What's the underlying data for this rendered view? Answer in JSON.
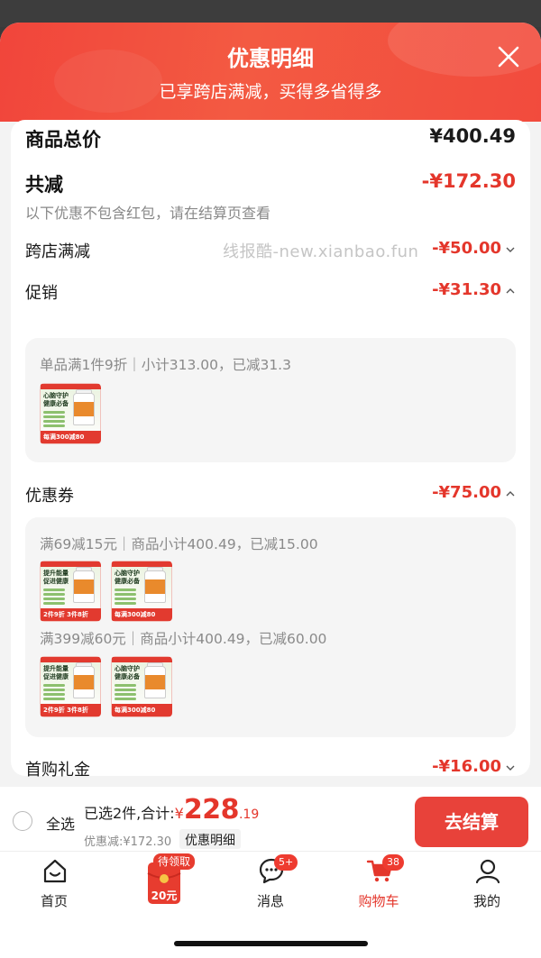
{
  "sheet": {
    "title": "优惠明细",
    "subtitle": "已享跨店满减，买得多省得多"
  },
  "summary": {
    "total_label": "商品总价",
    "total_value": "¥400.49",
    "reduce_label": "共减",
    "reduce_value": "-¥172.30",
    "note": "以下优惠不包含红包，请在结算页查看"
  },
  "watermark": "线报酷-new.xianbao.fun",
  "discounts": {
    "cross_store": {
      "label": "跨店满减",
      "value": "-¥50.00",
      "expanded": false
    },
    "promotion": {
      "label": "促销",
      "value": "-¥31.30",
      "expanded": true,
      "rule": "单品满1件9折｜小计313.00，已减31.3",
      "products": [
        {
          "tagline": "心脑守护 健康必备",
          "promo": "每满300减80"
        }
      ]
    },
    "coupon": {
      "label": "优惠券",
      "value": "-¥75.00",
      "expanded": true,
      "rules": [
        {
          "text": "满69减15元｜商品小计400.49，已减15.00",
          "products": [
            {
              "tagline": "提升能量 促进健康",
              "promo": "2件9折 3件8折"
            },
            {
              "tagline": "心脑守护 健康必备",
              "promo": "每满300减80"
            }
          ]
        },
        {
          "text": "满399减60元｜商品小计400.49，已减60.00",
          "products": [
            {
              "tagline": "提升能量 促进健康",
              "promo": "2件9折 3件8折"
            },
            {
              "tagline": "心脑守护 健康必备",
              "promo": "每满300减80"
            }
          ]
        }
      ]
    },
    "first_gift": {
      "label": "首购礼金",
      "value": "-¥16.00",
      "expanded": false
    }
  },
  "checkout": {
    "select_all": "全选",
    "selected_text": "已选2件,合计:",
    "currency": "¥",
    "total_int": "228",
    "total_dec": ".19",
    "discount_text": "优惠减:¥172.30",
    "detail_label": "优惠明细",
    "button": "去结算"
  },
  "tabs": [
    {
      "label": "首页",
      "icon": "home-icon"
    },
    {
      "label": "",
      "icon": "red-packet-icon",
      "badge": "待领取",
      "amount": "20元"
    },
    {
      "label": "消息",
      "icon": "message-icon",
      "badge": "5+"
    },
    {
      "label": "购物车",
      "icon": "cart-icon",
      "badge": "38",
      "active": true
    },
    {
      "label": "我的",
      "icon": "profile-icon"
    }
  ],
  "colors": {
    "accent": "#e4362b",
    "header": "#f1453b",
    "button": "#e8423a"
  }
}
